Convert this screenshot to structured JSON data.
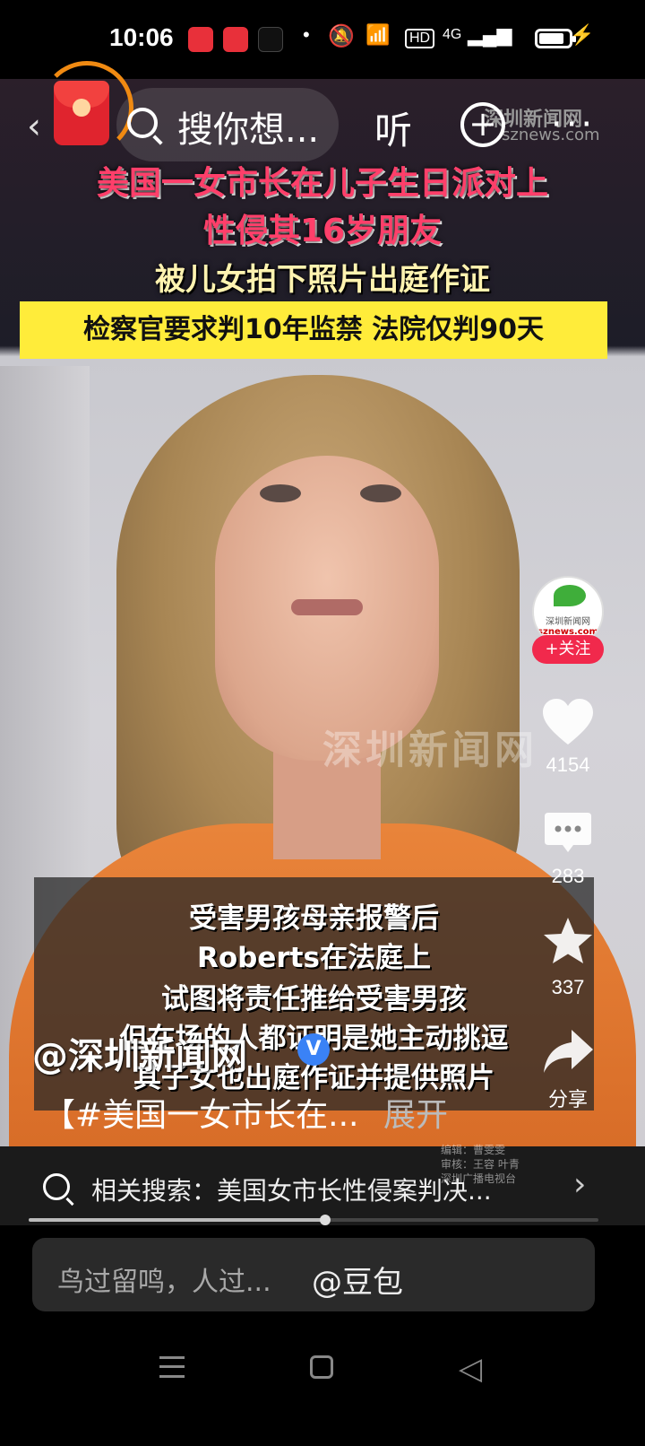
{
  "status_bar": {
    "time": "10:06",
    "network_label": "HD",
    "signal_label": "4G",
    "battery_level": 0.85
  },
  "top_bar": {
    "search_text": "搜你想...",
    "listen_label": "听",
    "logo_text_cn": "深圳新闻网",
    "logo_text_en": "sznews.com"
  },
  "video": {
    "headline_line1": "美国一女市长在儿子生日派对上",
    "headline_line2": "性侵其16岁朋友",
    "headline_line3": "被儿女拍下照片出庭作证",
    "banner": "检察官要求判10年监禁 法院仅判90天",
    "watermark": "深圳新闻网",
    "subtitles": [
      "受害男孩母亲报警后",
      "Roberts在法庭上",
      "试图将责任推给受害男孩",
      "但在场的人都证明是她主动挑逗",
      "其子女也出庭作证并提供照片"
    ],
    "credits": [
      "编辑：曹雯雯",
      "审核：王容 叶青",
      "深圳广播电视台"
    ]
  },
  "right_rail": {
    "avatar_text_cn": "深圳新闻网",
    "avatar_text_en": "sznews.com",
    "follow_label": "+关注",
    "like_count": "4154",
    "comment_count": "283",
    "favorite_count": "337",
    "share_label": "分享"
  },
  "post": {
    "author": "@深圳新闻网",
    "verified_label": "V",
    "caption": "【#美国一女市长在...",
    "expand_label": "展开"
  },
  "related_search": {
    "text": "相关搜索：美国女市长性侵案判决..."
  },
  "playback": {
    "progress": 0.52
  },
  "comment": {
    "placeholder": "鸟过留鸣，人过...",
    "mention": "@豆包"
  }
}
